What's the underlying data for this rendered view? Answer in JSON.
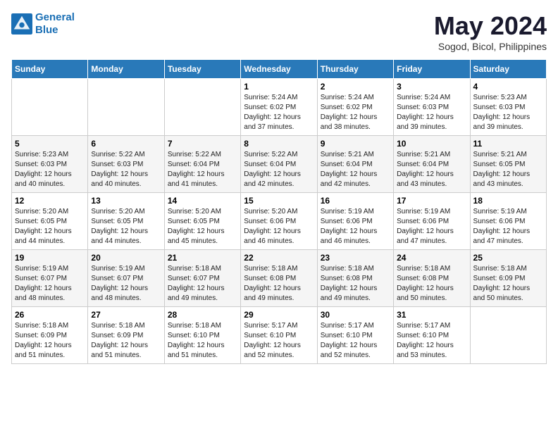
{
  "logo": {
    "line1": "General",
    "line2": "Blue"
  },
  "title": "May 2024",
  "location": "Sogod, Bicol, Philippines",
  "weekdays": [
    "Sunday",
    "Monday",
    "Tuesday",
    "Wednesday",
    "Thursday",
    "Friday",
    "Saturday"
  ],
  "weeks": [
    [
      {
        "day": "",
        "info": ""
      },
      {
        "day": "",
        "info": ""
      },
      {
        "day": "",
        "info": ""
      },
      {
        "day": "1",
        "info": "Sunrise: 5:24 AM\nSunset: 6:02 PM\nDaylight: 12 hours\nand 37 minutes."
      },
      {
        "day": "2",
        "info": "Sunrise: 5:24 AM\nSunset: 6:02 PM\nDaylight: 12 hours\nand 38 minutes."
      },
      {
        "day": "3",
        "info": "Sunrise: 5:24 AM\nSunset: 6:03 PM\nDaylight: 12 hours\nand 39 minutes."
      },
      {
        "day": "4",
        "info": "Sunrise: 5:23 AM\nSunset: 6:03 PM\nDaylight: 12 hours\nand 39 minutes."
      }
    ],
    [
      {
        "day": "5",
        "info": "Sunrise: 5:23 AM\nSunset: 6:03 PM\nDaylight: 12 hours\nand 40 minutes."
      },
      {
        "day": "6",
        "info": "Sunrise: 5:22 AM\nSunset: 6:03 PM\nDaylight: 12 hours\nand 40 minutes."
      },
      {
        "day": "7",
        "info": "Sunrise: 5:22 AM\nSunset: 6:04 PM\nDaylight: 12 hours\nand 41 minutes."
      },
      {
        "day": "8",
        "info": "Sunrise: 5:22 AM\nSunset: 6:04 PM\nDaylight: 12 hours\nand 42 minutes."
      },
      {
        "day": "9",
        "info": "Sunrise: 5:21 AM\nSunset: 6:04 PM\nDaylight: 12 hours\nand 42 minutes."
      },
      {
        "day": "10",
        "info": "Sunrise: 5:21 AM\nSunset: 6:04 PM\nDaylight: 12 hours\nand 43 minutes."
      },
      {
        "day": "11",
        "info": "Sunrise: 5:21 AM\nSunset: 6:05 PM\nDaylight: 12 hours\nand 43 minutes."
      }
    ],
    [
      {
        "day": "12",
        "info": "Sunrise: 5:20 AM\nSunset: 6:05 PM\nDaylight: 12 hours\nand 44 minutes."
      },
      {
        "day": "13",
        "info": "Sunrise: 5:20 AM\nSunset: 6:05 PM\nDaylight: 12 hours\nand 44 minutes."
      },
      {
        "day": "14",
        "info": "Sunrise: 5:20 AM\nSunset: 6:05 PM\nDaylight: 12 hours\nand 45 minutes."
      },
      {
        "day": "15",
        "info": "Sunrise: 5:20 AM\nSunset: 6:06 PM\nDaylight: 12 hours\nand 46 minutes."
      },
      {
        "day": "16",
        "info": "Sunrise: 5:19 AM\nSunset: 6:06 PM\nDaylight: 12 hours\nand 46 minutes."
      },
      {
        "day": "17",
        "info": "Sunrise: 5:19 AM\nSunset: 6:06 PM\nDaylight: 12 hours\nand 47 minutes."
      },
      {
        "day": "18",
        "info": "Sunrise: 5:19 AM\nSunset: 6:06 PM\nDaylight: 12 hours\nand 47 minutes."
      }
    ],
    [
      {
        "day": "19",
        "info": "Sunrise: 5:19 AM\nSunset: 6:07 PM\nDaylight: 12 hours\nand 48 minutes."
      },
      {
        "day": "20",
        "info": "Sunrise: 5:19 AM\nSunset: 6:07 PM\nDaylight: 12 hours\nand 48 minutes."
      },
      {
        "day": "21",
        "info": "Sunrise: 5:18 AM\nSunset: 6:07 PM\nDaylight: 12 hours\nand 49 minutes."
      },
      {
        "day": "22",
        "info": "Sunrise: 5:18 AM\nSunset: 6:08 PM\nDaylight: 12 hours\nand 49 minutes."
      },
      {
        "day": "23",
        "info": "Sunrise: 5:18 AM\nSunset: 6:08 PM\nDaylight: 12 hours\nand 49 minutes."
      },
      {
        "day": "24",
        "info": "Sunrise: 5:18 AM\nSunset: 6:08 PM\nDaylight: 12 hours\nand 50 minutes."
      },
      {
        "day": "25",
        "info": "Sunrise: 5:18 AM\nSunset: 6:09 PM\nDaylight: 12 hours\nand 50 minutes."
      }
    ],
    [
      {
        "day": "26",
        "info": "Sunrise: 5:18 AM\nSunset: 6:09 PM\nDaylight: 12 hours\nand 51 minutes."
      },
      {
        "day": "27",
        "info": "Sunrise: 5:18 AM\nSunset: 6:09 PM\nDaylight: 12 hours\nand 51 minutes."
      },
      {
        "day": "28",
        "info": "Sunrise: 5:18 AM\nSunset: 6:10 PM\nDaylight: 12 hours\nand 51 minutes."
      },
      {
        "day": "29",
        "info": "Sunrise: 5:17 AM\nSunset: 6:10 PM\nDaylight: 12 hours\nand 52 minutes."
      },
      {
        "day": "30",
        "info": "Sunrise: 5:17 AM\nSunset: 6:10 PM\nDaylight: 12 hours\nand 52 minutes."
      },
      {
        "day": "31",
        "info": "Sunrise: 5:17 AM\nSunset: 6:10 PM\nDaylight: 12 hours\nand 53 minutes."
      },
      {
        "day": "",
        "info": ""
      }
    ]
  ]
}
